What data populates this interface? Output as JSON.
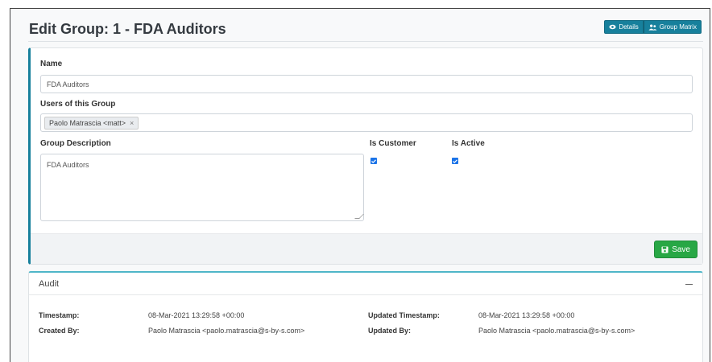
{
  "page": {
    "title": "Edit Group: 1 - FDA Auditors",
    "buttons": {
      "details": "Details",
      "group_matrix": "Group Matrix"
    }
  },
  "form": {
    "name_label": "Name",
    "name_value": "FDA Auditors",
    "users_label": "Users of this Group",
    "users": [
      {
        "text": "Paolo Matrascia <matt>",
        "remove": "×"
      }
    ],
    "description_label": "Group Description",
    "description_value": "FDA Auditors",
    "is_customer_label": "Is Customer",
    "is_customer_checked": true,
    "is_active_label": "Is Active",
    "is_active_checked": true,
    "save_label": "Save"
  },
  "audit": {
    "title": "Audit",
    "timestamp_label": "Timestamp:",
    "timestamp_value": "08-Mar-2021 13:29:58 +00:00",
    "created_by_label": "Created By:",
    "created_by_value": "Paolo Matrascia <paolo.matrascia@s-by-s.com>",
    "updated_timestamp_label": "Updated Timestamp:",
    "updated_timestamp_value": "08-Mar-2021 13:29:58 +00:00",
    "updated_by_label": "Updated By:",
    "updated_by_value": "Paolo Matrascia <paolo.matrascia@s-by-s.com>"
  },
  "colors": {
    "accent": "#17809c",
    "save": "#28a745",
    "checkbox": "#1a73e8"
  },
  "icons": {
    "details": "eye-icon",
    "group_matrix": "users-icon",
    "save": "floppy-disk-icon",
    "audit_toggle": "minus-icon"
  }
}
